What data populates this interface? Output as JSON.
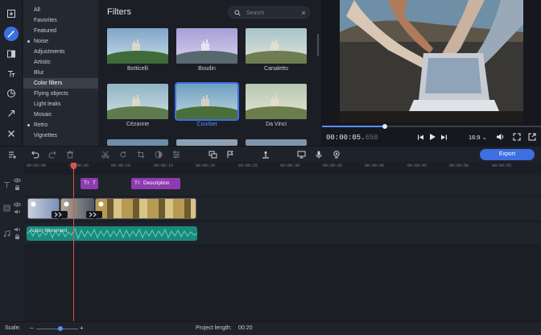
{
  "categories": [
    {
      "label": "All",
      "dot": false
    },
    {
      "label": "Favorites",
      "dot": false
    },
    {
      "label": "Featured",
      "dot": false
    },
    {
      "label": "Noise",
      "dot": true
    },
    {
      "label": "Adjustments",
      "dot": false
    },
    {
      "label": "Artistic",
      "dot": false
    },
    {
      "label": "Blur",
      "dot": false
    },
    {
      "label": "Color filters",
      "dot": false,
      "selected": true
    },
    {
      "label": "Flying objects",
      "dot": false
    },
    {
      "label": "Light leaks",
      "dot": false
    },
    {
      "label": "Mosaic",
      "dot": false
    },
    {
      "label": "Retro",
      "dot": true
    },
    {
      "label": "Vignettes",
      "dot": false
    }
  ],
  "filters_panel": {
    "title": "Filters",
    "search_placeholder": "Search",
    "items": [
      {
        "name": "Botticelli",
        "sky": "#7fa6c9",
        "hill": "#3f6b3a"
      },
      {
        "name": "Boudin",
        "sky": "#a79fd6",
        "hill": "#57686e"
      },
      {
        "name": "Canaletto",
        "sky": "#a8c3c9",
        "hill": "#6f7d52"
      },
      {
        "name": "Cézanne",
        "sky": "#8fb3c4",
        "hill": "#5e7b4e"
      },
      {
        "name": "Courbet",
        "sky": "#6f9fbf",
        "hill": "#4c6e3a",
        "selected": true
      },
      {
        "name": "Da Vinci",
        "sky": "#b6c7b2",
        "hill": "#6a7d4a"
      }
    ]
  },
  "preview": {
    "timecode_main": "00:00:05.",
    "timecode_ms": "650",
    "progress": 0.29,
    "aspect_ratio": "16:9"
  },
  "toolbar": {
    "export_label": "Export"
  },
  "timeline": {
    "ruler": [
      "00:00:00",
      "00:00:05",
      "00:00:10",
      "00:00:15",
      "00:00:20",
      "00:00:25",
      "00:00:30",
      "00:00:35",
      "00:00:40",
      "00:00:45",
      "00:00:50",
      "00:00:55"
    ],
    "text_clip_1": "T",
    "text_clip_2": "Description",
    "audio_clip": "Action Movement"
  },
  "status": {
    "scale_label": "Scale:",
    "project_length_label": "Project length:",
    "project_length_value": "00:20"
  },
  "icons": {
    "import": "import-icon",
    "filters": "magic-wand-icon",
    "transitions": "transitions-icon",
    "titles": "titles-icon",
    "stickers": "stickers-icon",
    "callouts": "arrow-icon",
    "more_tools": "tools-icon"
  },
  "colors": {
    "accent": "#3d6fe0",
    "text_clip": "#8e3bb0",
    "audio_clip": "#1b8a7c",
    "playhead": "#d9534f"
  }
}
